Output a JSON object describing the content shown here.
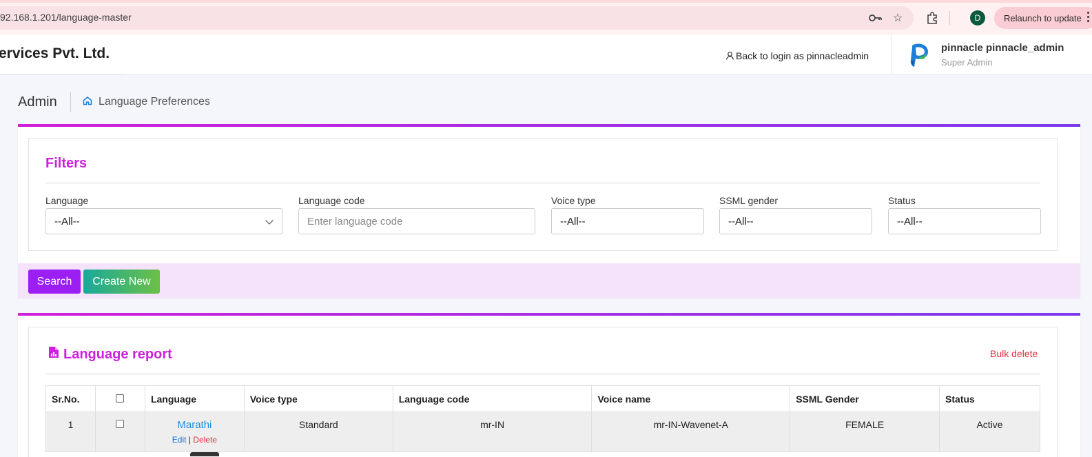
{
  "browser": {
    "url": "92.168.1.201/language-master",
    "profile_initial": "D",
    "relaunch_label": "Relaunch to update",
    "icons": [
      "key-icon",
      "star-icon",
      "extensions-icon",
      "kebab-menu-icon"
    ]
  },
  "header": {
    "company": "ervices Pvt. Ltd.",
    "back_link": "Back to login as pinnacleadmin",
    "user_name": "pinnacle pinnacle_admin",
    "user_role": "Super Admin"
  },
  "breadcrumb": {
    "section": "Admin",
    "page": "Language Preferences"
  },
  "filters": {
    "title": "Filters",
    "fields": [
      {
        "label": "Language",
        "value": "--All--"
      },
      {
        "label": "Language code",
        "placeholder": "Enter language code"
      },
      {
        "label": "Voice type",
        "value": "--All--"
      },
      {
        "label": "SSML gender",
        "value": "--All--"
      },
      {
        "label": "Status",
        "value": "--All--"
      }
    ],
    "search_label": "Search",
    "create_label": "Create New"
  },
  "report": {
    "title": "Language report",
    "bulk_delete": "Bulk delete",
    "columns": [
      "Sr.No.",
      "",
      "Language",
      "Voice type",
      "Language code",
      "Voice name",
      "SSML Gender",
      "Status"
    ],
    "rows": [
      {
        "sr": "1",
        "language": "Marathi",
        "edit": "Edit",
        "sep": "|",
        "delete": "Delete",
        "voice_type": "Standard",
        "language_code": "mr-IN",
        "voice_name": "mr-IN-Wavenet-A",
        "ssml_gender": "FEMALE",
        "status": "Active"
      }
    ]
  },
  "colors": {
    "accent": "#cc22dd",
    "search_button": "#9b1ef3",
    "create_button": "#19a99a",
    "danger": "#e3303f",
    "link": "#1a8ee0"
  }
}
